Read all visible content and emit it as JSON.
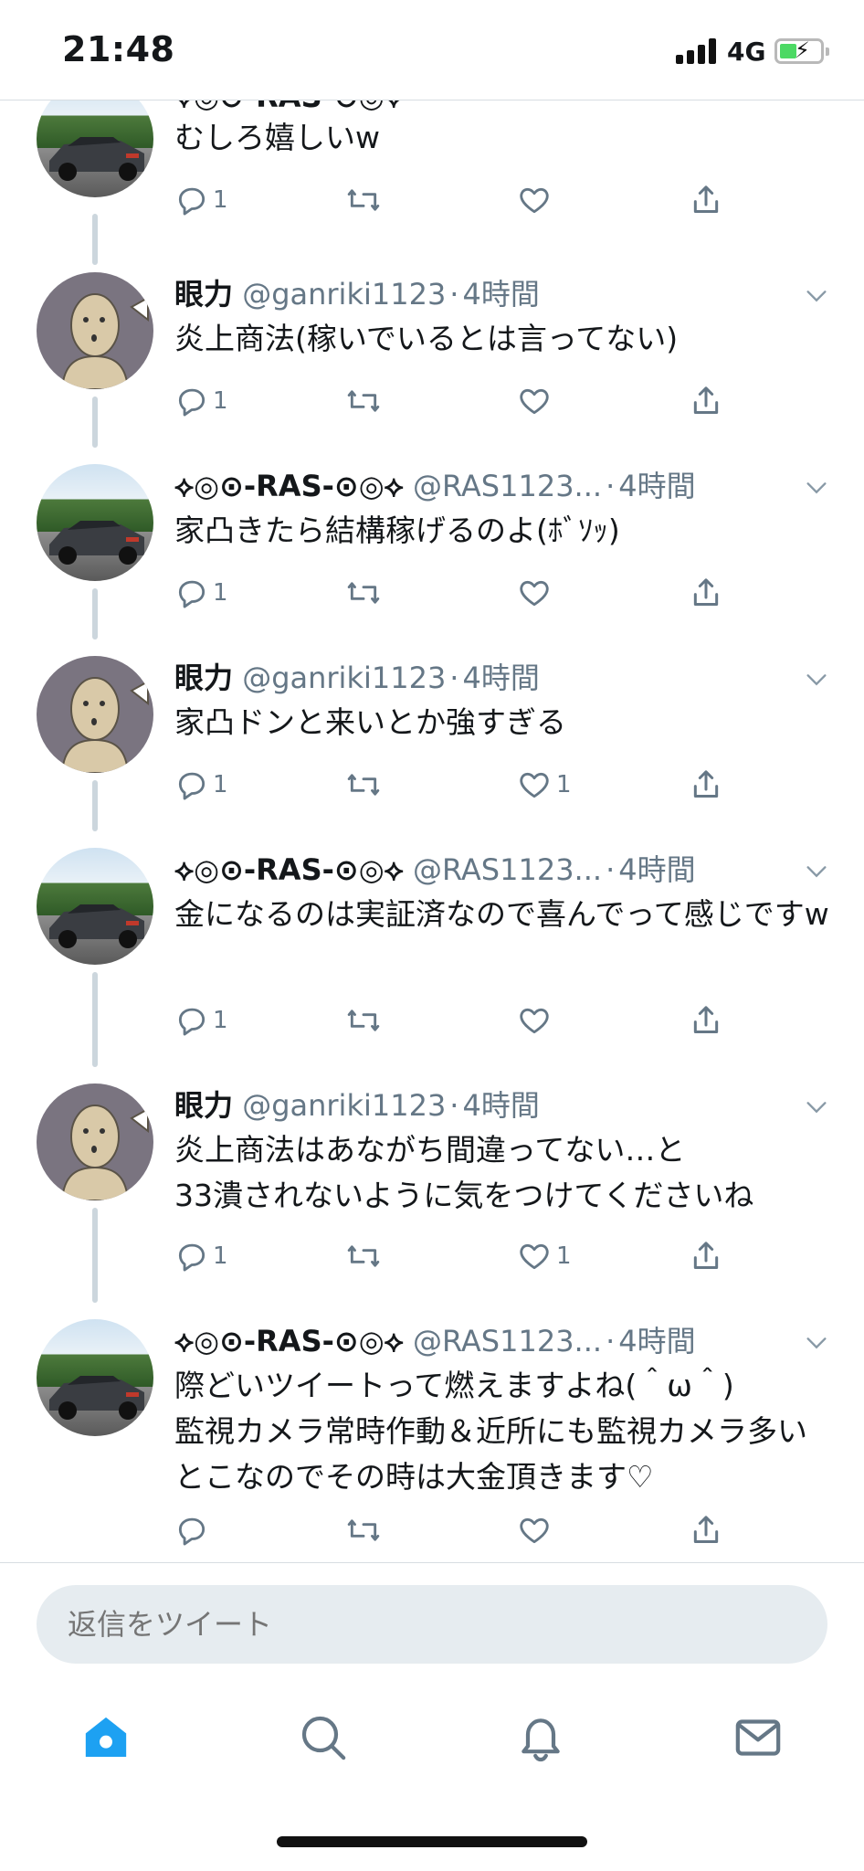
{
  "status_bar": {
    "time": "21:48",
    "network": "4G"
  },
  "tweets": [
    {
      "avatar": "car-avatar",
      "body": "むしろ嬉しいw",
      "reply_count": "1",
      "like_count": ""
    },
    {
      "avatar": "doll-avatar",
      "name": "眼力",
      "handle": "@ganriki1123",
      "time": "4時間",
      "body": "炎上商法(稼いでいるとは言ってない)",
      "reply_count": "1",
      "like_count": ""
    },
    {
      "avatar": "car-avatar",
      "name": "⟡◎⊙-RAS-⊙◎⟡",
      "handle": "@RAS1123...",
      "time": "4時間",
      "body": "家凸きたら結構稼げるのよ(ﾎﾞｿｯ)",
      "reply_count": "1",
      "like_count": ""
    },
    {
      "avatar": "doll-avatar",
      "name": "眼力",
      "handle": "@ganriki1123",
      "time": "4時間",
      "body": "家凸ドンと来いとか強すぎる",
      "reply_count": "1",
      "like_count": "1"
    },
    {
      "avatar": "car-avatar",
      "name": "⟡◎⊙-RAS-⊙◎⟡",
      "handle": "@RAS1123...",
      "time": "4時間",
      "body": "金になるのは実証済なので喜んでって感じですw",
      "reply_count": "1",
      "like_count": ""
    },
    {
      "avatar": "doll-avatar",
      "name": "眼力",
      "handle": "@ganriki1123",
      "time": "4時間",
      "body": "炎上商法はあながち間違ってない…と\n33潰されないように気をつけてくださいね",
      "reply_count": "1",
      "like_count": "1"
    },
    {
      "avatar": "car-avatar",
      "name": "⟡◎⊙-RAS-⊙◎⟡",
      "handle": "@RAS1123...",
      "time": "4時間",
      "body": "際どいツイートって燃えますよね(＾ω＾)\n監視カメラ常時作動＆近所にも監視カメラ多いとこなのでその時は大金頂きます♡",
      "reply_count": "",
      "like_count": ""
    }
  ],
  "reply_bar": {
    "placeholder": "返信をツイート"
  },
  "tabs": [
    "home-icon",
    "search-icon",
    "notifications-icon",
    "messages-icon"
  ],
  "colors": {
    "accent": "#1da1f2",
    "muted": "#657786",
    "thread_line": "#ccd6dd",
    "input_bg": "#e6ecf0"
  }
}
